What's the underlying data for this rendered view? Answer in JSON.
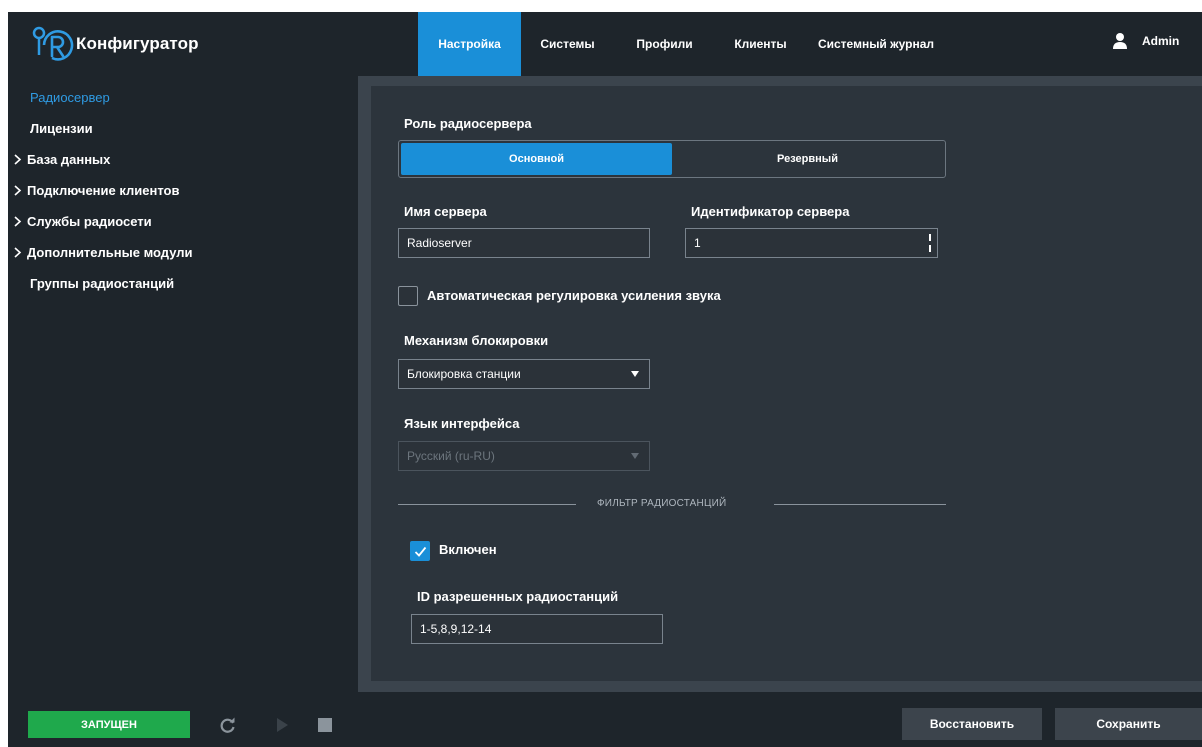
{
  "app": {
    "title": "Конфигуратор"
  },
  "nav": {
    "tabs": [
      {
        "label": "Настройка",
        "active": true
      },
      {
        "label": "Системы",
        "active": false
      },
      {
        "label": "Профили",
        "active": false
      },
      {
        "label": "Клиенты",
        "active": false
      },
      {
        "label": "Системный журнал",
        "active": false
      }
    ],
    "user": {
      "icon": "user-icon",
      "name": "Admin"
    }
  },
  "sidebar": {
    "items": [
      {
        "label": "Радиосервер",
        "active": true,
        "expandable": false
      },
      {
        "label": "Лицензии",
        "active": false,
        "expandable": false
      },
      {
        "label": "База данных",
        "active": false,
        "expandable": true
      },
      {
        "label": "Подключение клиентов",
        "active": false,
        "expandable": true
      },
      {
        "label": "Службы радиосети",
        "active": false,
        "expandable": true
      },
      {
        "label": "Дополнительные модули",
        "active": false,
        "expandable": true
      },
      {
        "label": "Группы радиостанций",
        "active": false,
        "expandable": false
      }
    ]
  },
  "form": {
    "role": {
      "label": "Роль радиосервера",
      "options": [
        "Основной",
        "Резервный"
      ],
      "selected": "Основной"
    },
    "server_name": {
      "label": "Имя сервера",
      "value": "Radioserver"
    },
    "server_id": {
      "label": "Идентификатор сервера",
      "value": "1"
    },
    "agc": {
      "label": "Автоматическая регулировка усиления звука",
      "checked": false
    },
    "lock": {
      "label": "Механизм блокировки",
      "value": "Блокировка станции"
    },
    "language": {
      "label": "Язык интерфейса",
      "value": "Русский (ru-RU)",
      "disabled": true
    },
    "filter": {
      "title": "ФИЛЬТР РАДИОСТАНЦИЙ",
      "enabled": {
        "label": "Включен",
        "checked": true
      },
      "ids": {
        "label": "ID разрешенных радиостанций",
        "value": "1-5,8,9,12-14"
      }
    }
  },
  "footer": {
    "status": "ЗАПУЩЕН",
    "restore_label": "Восстановить",
    "save_label": "Сохранить"
  },
  "colors": {
    "accent": "#1a8fd8",
    "status_running": "#1fa94c",
    "background": "#1e252b",
    "panel": "#2c343c"
  }
}
